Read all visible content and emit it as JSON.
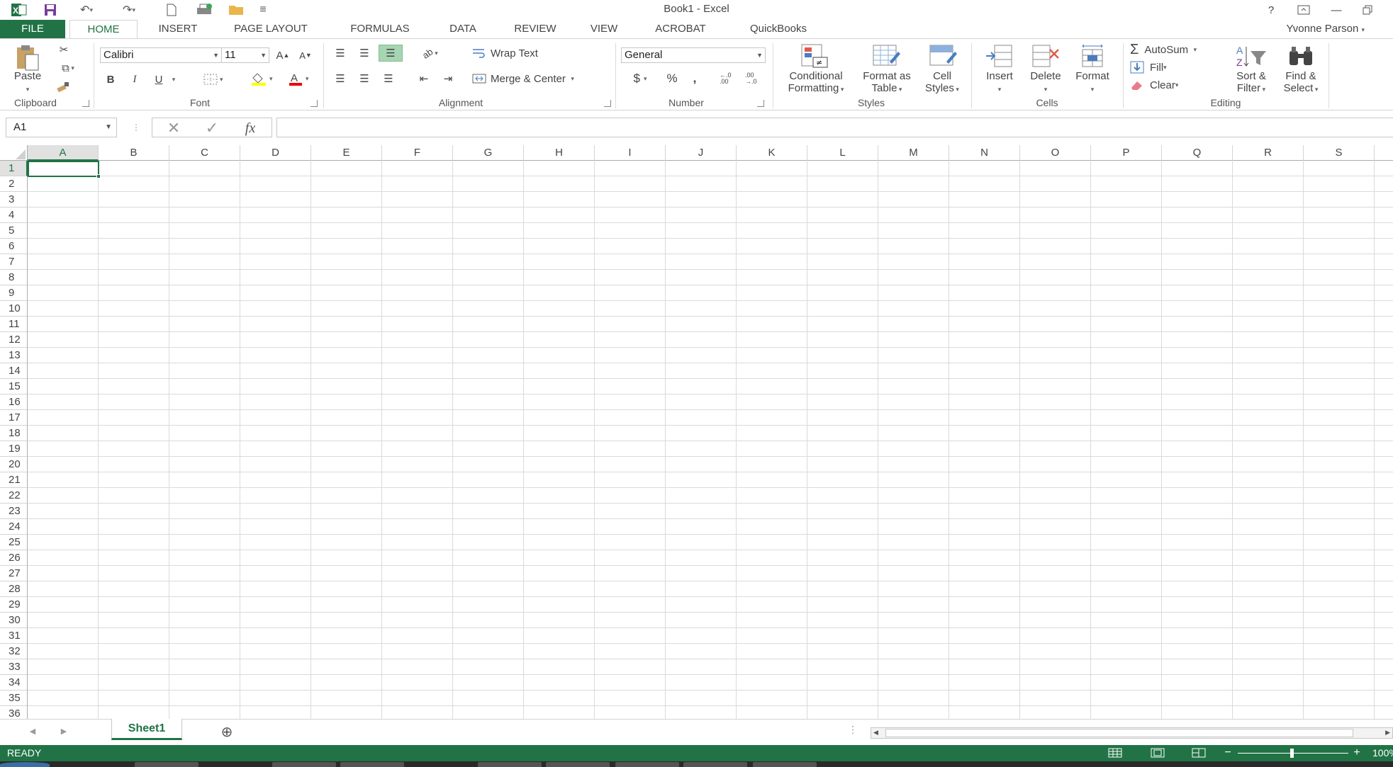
{
  "window": {
    "title": "Book1 - Excel",
    "help": "?",
    "user": "Yvonne Parson"
  },
  "tabs": [
    "FILE",
    "HOME",
    "INSERT",
    "PAGE LAYOUT",
    "FORMULAS",
    "DATA",
    "REVIEW",
    "VIEW",
    "ACROBAT",
    "QuickBooks"
  ],
  "ribbon": {
    "clipboard": {
      "label": "Clipboard",
      "paste": "Paste"
    },
    "font": {
      "label": "Font",
      "name": "Calibri",
      "size": "11",
      "bold": "B",
      "italic": "I",
      "underline": "U",
      "font_color_glyph": "A"
    },
    "alignment": {
      "label": "Alignment",
      "wrap_text": "Wrap Text",
      "merge_center": "Merge & Center"
    },
    "number": {
      "label": "Number",
      "format": "General",
      "currency": "$",
      "percent": "%",
      "comma": ",",
      "inc_decimal": "←.0 .00",
      "dec_decimal": ".00 →.0"
    },
    "styles": {
      "label": "Styles",
      "conditional": [
        "Conditional",
        "Formatting"
      ],
      "format_table": [
        "Format as",
        "Table"
      ],
      "cell_styles": [
        "Cell",
        "Styles"
      ]
    },
    "cells": {
      "label": "Cells",
      "insert": "Insert",
      "delete": "Delete",
      "format": "Format"
    },
    "editing": {
      "label": "Editing",
      "autosum": "AutoSum",
      "fill": "Fill",
      "clear": "Clear",
      "sort": [
        "Sort &",
        "Filter"
      ],
      "find": [
        "Find &",
        "Select"
      ]
    }
  },
  "formula_bar": {
    "name_box": "A1",
    "fx": "fx",
    "value": ""
  },
  "grid": {
    "columns": [
      "A",
      "B",
      "C",
      "D",
      "E",
      "F",
      "G",
      "H",
      "I",
      "J",
      "K",
      "L",
      "M",
      "N",
      "O",
      "P",
      "Q",
      "R",
      "S"
    ],
    "rows": [
      "1",
      "2",
      "3",
      "4",
      "5",
      "6",
      "7",
      "8",
      "9",
      "10",
      "11",
      "12",
      "13",
      "14",
      "15",
      "16",
      "17",
      "18",
      "19",
      "20",
      "21",
      "22",
      "23",
      "24",
      "25",
      "26",
      "27",
      "28",
      "29",
      "30",
      "31",
      "32",
      "33",
      "34",
      "35",
      "36"
    ],
    "active_cell": "A1"
  },
  "sheets": {
    "tabs": [
      "Sheet1"
    ],
    "active": "Sheet1"
  },
  "status": {
    "text": "READY",
    "zoom": "100%"
  },
  "colors": {
    "accent": "#217346"
  }
}
